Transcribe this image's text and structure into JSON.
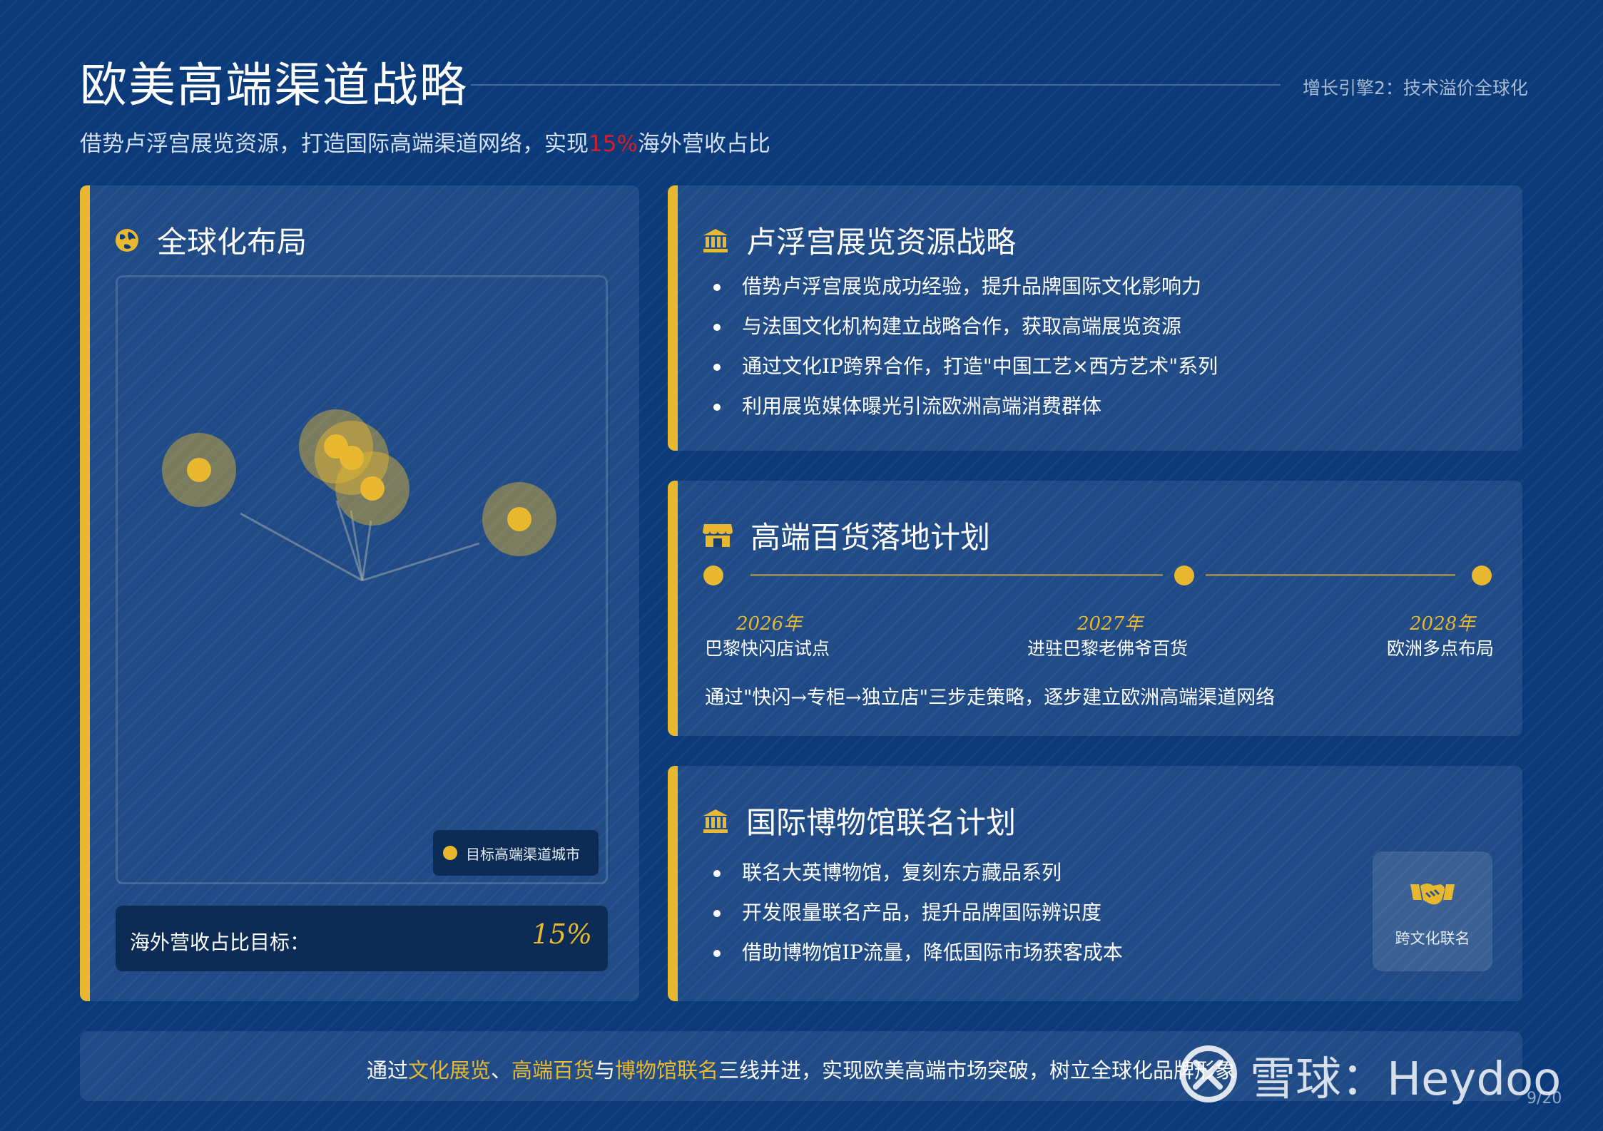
{
  "header": {
    "title": "欧美高端渠道战略",
    "tag": "增长引擎2：技术溢价全球化",
    "subtitle_before": "借势卢浮宫展览资源，打造国际高端渠道网络，实现",
    "subtitle_highlight": "15%",
    "subtitle_after": "海外营收占比"
  },
  "global_card": {
    "title": "全球化布局",
    "legend_label": "目标高端渠道城市",
    "target_label": "海外营收占比目标：",
    "target_value": "15%"
  },
  "louvre_card": {
    "title": "卢浮宫展览资源战略",
    "bullets": [
      "借势卢浮宫展览成功经验，提升品牌国际文化影响力",
      "与法国文化机构建立战略合作，获取高端展览资源",
      "通过文化IP跨界合作，打造\"中国工艺×西方艺术\"系列",
      "利用展览媒体曝光引流欧洲高端消费群体"
    ]
  },
  "dept_card": {
    "title": "高端百货落地计划",
    "timeline": [
      {
        "year": "2026年",
        "desc": "巴黎快闪店试点"
      },
      {
        "year": "2027年",
        "desc": "进驻巴黎老佛爷百货"
      },
      {
        "year": "2028年",
        "desc": "欧洲多点布局"
      }
    ],
    "note": "通过\"快闪→专柜→独立店\"三步走策略，逐步建立欧洲高端渠道网络"
  },
  "museum_card": {
    "title": "国际博物馆联名计划",
    "bullets": [
      "联名大英博物馆，复刻东方藏品系列",
      "开发限量联名产品，提升品牌国际辨识度",
      "借助博物馆IP流量，降低国际市场获客成本"
    ],
    "badge_label": "跨文化联名"
  },
  "footer": {
    "text_1": "通过",
    "hl_1": "文化展览",
    "sep_1": "、",
    "hl_2": "高端百货",
    "sep_2": "与",
    "hl_3": "博物馆联名",
    "text_2": "三线并进，实现欧美高端市场突破，树立全球化品牌形象"
  },
  "watermark": "雪球：Heydoo",
  "page_number": "9/20",
  "colors": {
    "background": "#0a3a7a",
    "accent_gold": "#e8b830",
    "highlight_red": "#d0202a"
  },
  "icons": {
    "global": "globe-icon",
    "louvre": "museum-icon",
    "dept": "store-icon",
    "museum": "museum-icon",
    "badge": "handshake-icon"
  }
}
